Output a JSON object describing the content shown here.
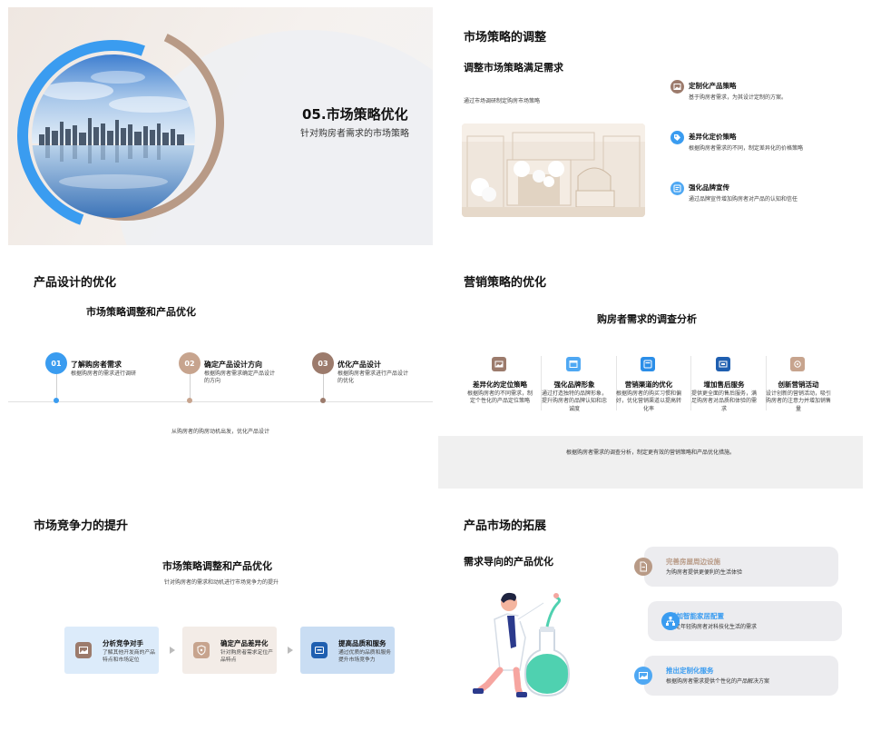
{
  "slide1": {
    "title": "05.市场策略优化",
    "subtitle": "针对购房者需求的市场策略"
  },
  "slide2": {
    "title": "市场策略的调整",
    "subtitle": "调整市场策略满足需求",
    "caption": "通过市场调研制定购房市场策略",
    "items": [
      {
        "name": "定制化产品策略",
        "text": "基于购房者需求，为其设计定制的方案。",
        "icon": "image-icon"
      },
      {
        "name": "差异化定价策略",
        "text": "根据购房者需求的不同，制定差异化的价格策略",
        "icon": "price-tag-icon"
      },
      {
        "name": "强化品牌宣传",
        "text": "通过品牌宣传增加购房者对产品的认知和信任",
        "icon": "megaphone-icon"
      }
    ]
  },
  "slide3": {
    "title": "产品设计的优化",
    "subtitle": "市场策略调整和产品优化",
    "steps": [
      {
        "num": "01",
        "name": "了解购房者需求",
        "text": "根据购房者的需求进行调研"
      },
      {
        "num": "02",
        "name": "确定产品设计方向",
        "text": "根据购房者需求确定产品设计的方向"
      },
      {
        "num": "03",
        "name": "优化产品设计",
        "text": "根据购房者需求进行产品设计的优化"
      }
    ],
    "caption": "从购房者的购房动机出发，优化产品设计"
  },
  "slide4": {
    "title": "营销策略的优化",
    "subtitle": "购房者需求的调查分析",
    "columns": [
      {
        "name": "差异化的定位策略",
        "text": "根据购房者的不同需求，制定个性化的产品定位策略"
      },
      {
        "name": "强化品牌形象",
        "text": "通过打造独特的品牌形象，提升购房者的品牌认知和忠诚度"
      },
      {
        "name": "营销渠道的优化",
        "text": "根据购房者的购买习惯和偏好，优化营销渠道以提高转化率"
      },
      {
        "name": "增加售后服务",
        "text": "提供更全面的售后服务，满足购房者对品质和体验的需求"
      },
      {
        "name": "创新营销活动",
        "text": "设计创新的营销活动，吸引购房者的注意力并增加销售量"
      }
    ],
    "summary": "根据购房者需求的调查分析，制定更有效的营销策略和产品优化措施。"
  },
  "slide5": {
    "title": "市场竞争力的提升",
    "subtitle": "市场策略调整和产品优化",
    "caption": "针对购房者的需求和动机进行市场竞争力的提升",
    "cards": [
      {
        "name": "分析竞争对手",
        "text": "了解其他开发商的产品特点和市场定位"
      },
      {
        "name": "确定产品差异化",
        "text": "针对购房者需求定位产品特点"
      },
      {
        "name": "提高品质和服务",
        "text": "通过优质的品质和服务提升市场竞争力"
      }
    ]
  },
  "slide6": {
    "title": "产品市场的拓展",
    "subtitle": "需求导向的产品优化",
    "items": [
      {
        "name": "完善房屋周边设施",
        "text": "为购房者提供更便利的生活体验"
      },
      {
        "name": "增加智能家居配置",
        "text": "满足年轻购房者对科技化生活的需求"
      },
      {
        "name": "推出定制化服务",
        "text": "根据购房者需求提供个性化的产品解决方案"
      }
    ]
  },
  "colors": {
    "blue": "#3a9cf0",
    "tan": "#b89a86",
    "brown": "#9c7b6c",
    "navy": "#1f5fb0"
  }
}
